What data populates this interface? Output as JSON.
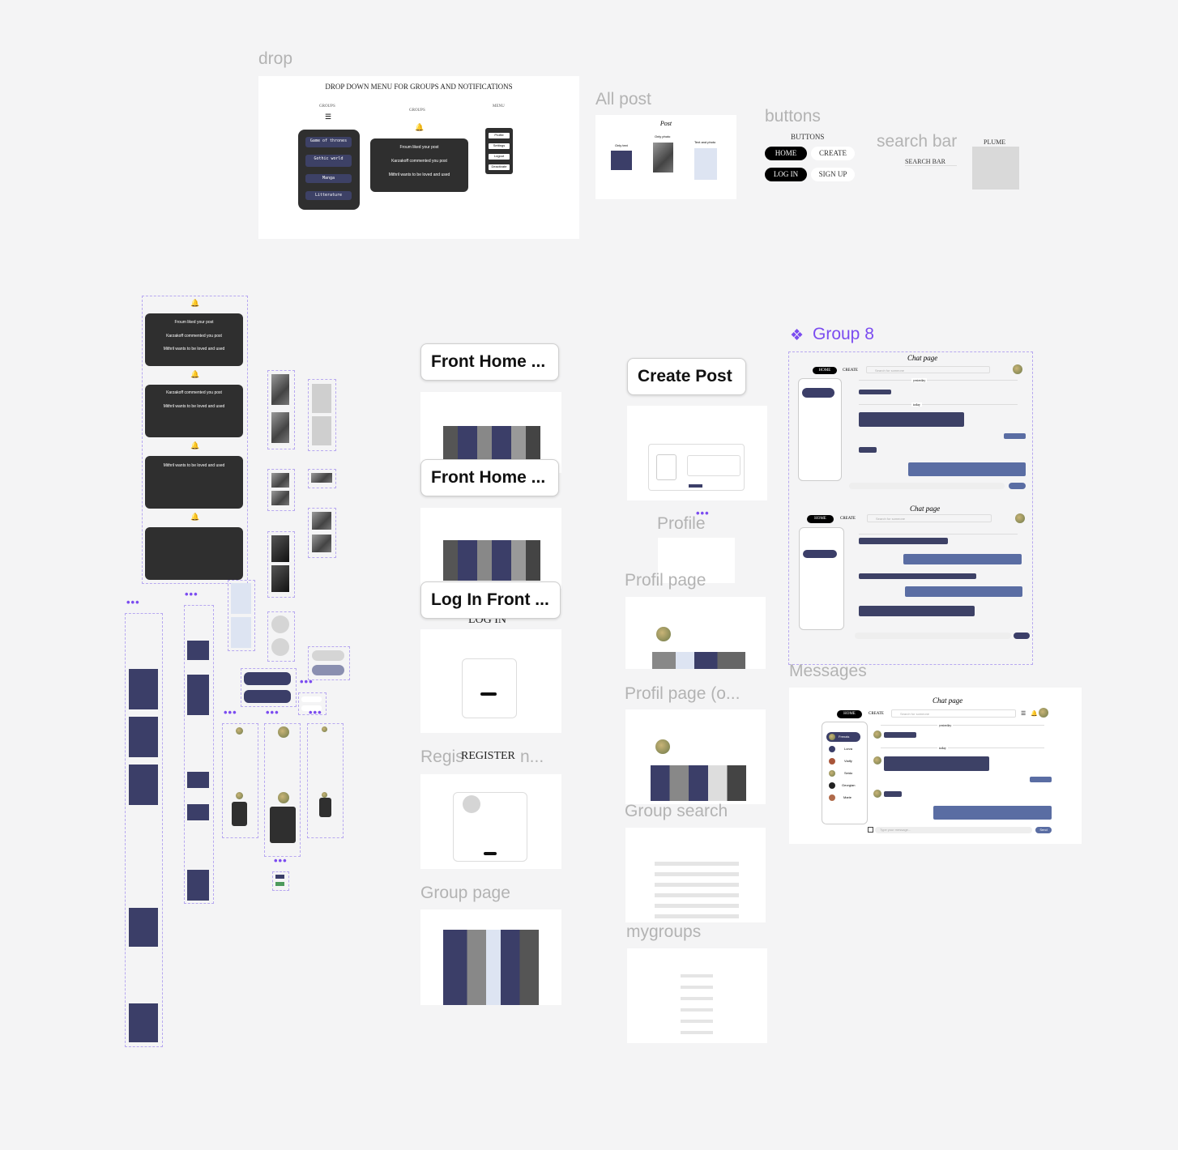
{
  "frames": {
    "drop": "drop",
    "all_post": "All post",
    "buttons": "buttons",
    "search_bar": "search bar",
    "front_home_1": "Front Home ...",
    "front_home_2": "Front Home ...",
    "login_front": "Log In Front ...",
    "create_post": "Create Post",
    "profile": "Profile",
    "profil_page": "Profil page",
    "profil_page_o": "Profil page (o...",
    "group_search": "Group search",
    "mygroups": "mygroups",
    "register": "Regis",
    "register_overlap": "REGISTER",
    "register_tail": "n...",
    "login_under": "LOG IN",
    "group_page": "Group page",
    "group8": "Group 8",
    "messages": "Messages"
  },
  "drop": {
    "title": "DROP DOWN MENU FOR GROUPS AND NOTIFICATIONS",
    "groups_label": "GROUPS",
    "groups_label2": "GROUPS",
    "menu_label": "MENU",
    "group_items": [
      "Game of thrones",
      "Gothic world",
      "Manga",
      "Litterature"
    ],
    "notifications": [
      "Froum liked your post",
      "Karzakoff commented you post",
      "Mithril wants to be loved and used"
    ],
    "menu_items": [
      "Profile",
      "Settings",
      "Logout",
      "Deactivate"
    ]
  },
  "all_post": {
    "heading": "Post",
    "col1": "Only text",
    "col2": "Only photo",
    "col3": "Text and photo"
  },
  "buttons": {
    "heading": "BUTTONS",
    "home": "HOME",
    "create": "CREATE",
    "login": "LOG IN",
    "signup": "SIGN UP"
  },
  "search": {
    "label": "SEARCH BAR",
    "plume": "PLUME"
  },
  "notif_panel": {
    "items": [
      "Froum liked your post",
      "Karzakoff commented you post",
      "Mithril wants to be loved and used"
    ],
    "items2": [
      "Karzakoff commented you post",
      "Mithril wants to be loved and used"
    ],
    "items3": [
      "Mithril wants to be loved and used"
    ]
  },
  "messages": {
    "heading": "Chat page",
    "home": "HOME",
    "create": "CREATE",
    "search_placeholder": "Search for someone",
    "yesterday": "yesterday",
    "today": "today",
    "send": "Send",
    "input_placeholder": "Type your message...",
    "contacts": [
      "Frenais",
      "Lorva",
      "Vialfy",
      "Seido",
      "Georgian",
      "Marie"
    ]
  },
  "colors": {
    "navy": "#3b3e68",
    "blue": "#5a6da3",
    "dark": "#2f2f2f",
    "accent": "#7b4cf0"
  }
}
